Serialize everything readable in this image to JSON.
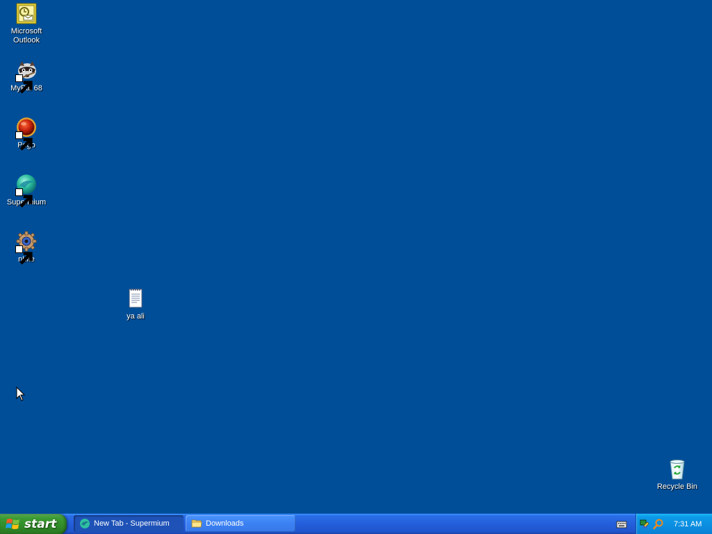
{
  "desktop": {
    "background_color": "#004e98",
    "icons": [
      {
        "label": "Microsoft\nOutlook",
        "icon": "outlook-icon",
        "shortcut": false
      },
      {
        "label": "MyPal 68",
        "icon": "mypal-icon",
        "shortcut": true
      },
      {
        "label": "Pego",
        "icon": "pego-icon",
        "shortcut": true
      },
      {
        "label": "Supermium",
        "icon": "supermium-icon",
        "shortcut": true
      },
      {
        "label": "nLite",
        "icon": "nlite-icon",
        "shortcut": true
      },
      {
        "label": "ya ali",
        "icon": "text-document-icon",
        "shortcut": false
      },
      {
        "label": "Recycle Bin",
        "icon": "recycle-bin-icon",
        "shortcut": false
      }
    ]
  },
  "taskbar": {
    "start_label": "start",
    "tasks": [
      {
        "label": "New Tab - Supermium",
        "icon": "supermium-icon",
        "active": true
      },
      {
        "label": "Downloads",
        "icon": "folder-icon",
        "active": false
      }
    ],
    "language_icon": "keyboard-icon",
    "tray": {
      "icons": [
        "network-icon",
        "search-icon"
      ],
      "clock": "7:31 AM"
    }
  }
}
